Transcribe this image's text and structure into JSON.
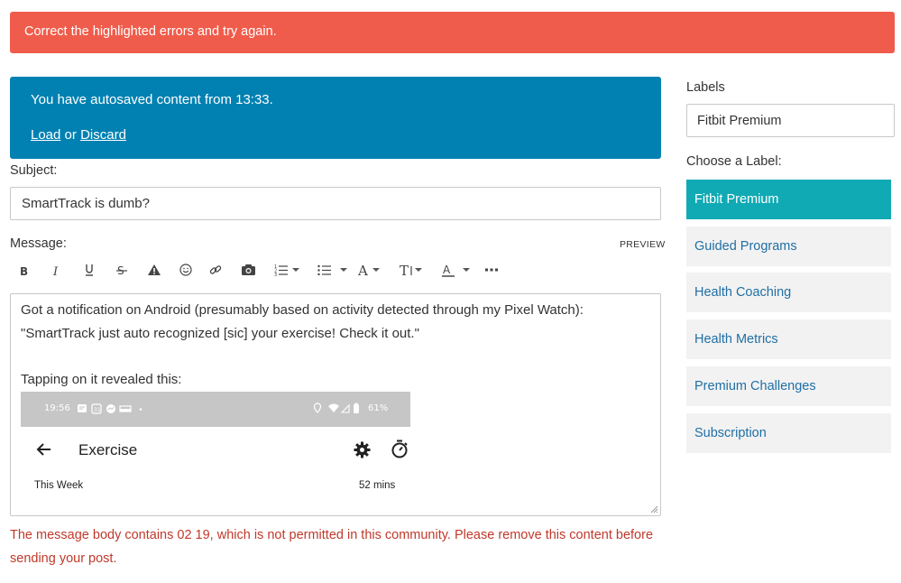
{
  "error_banner": {
    "text": "Correct the highlighted errors and try again."
  },
  "autosave": {
    "message": "You have autosaved content from 13:33.",
    "load": "Load",
    "or": "or",
    "discard": "Discard"
  },
  "subject": {
    "label": "Subject:",
    "value": "SmartTrack is dumb?"
  },
  "message": {
    "label": "Message:",
    "preview": "PREVIEW",
    "lines": [
      "Got a notification on Android (presumably based on activity detected through my Pixel Watch):",
      "\"SmartTrack just auto recognized [sic] your exercise! Check it out.\"",
      "Tapping on it revealed this:"
    ],
    "screenshot": {
      "time": "19:56",
      "battery": "61%",
      "title": "Exercise",
      "week_label": "This Week",
      "week_value": "52 mins"
    }
  },
  "error_message": "The message body contains 02 19, which is not permitted in this community. Please remove this content before sending your post.",
  "sidebar": {
    "labels_heading": "Labels",
    "labels_value": "Fitbit Premium",
    "choose_heading": "Choose a Label:",
    "items": [
      {
        "label": "Fitbit Premium"
      },
      {
        "label": "Guided Programs"
      },
      {
        "label": "Health Coaching"
      },
      {
        "label": "Health Metrics"
      },
      {
        "label": "Premium Challenges"
      },
      {
        "label": "Subscription"
      }
    ]
  },
  "colors": {
    "error": "#f05c4b",
    "autosave": "#0081b2",
    "active_label": "#10aab4",
    "label_link": "#1f6fa5",
    "error_text": "#c0392b"
  }
}
